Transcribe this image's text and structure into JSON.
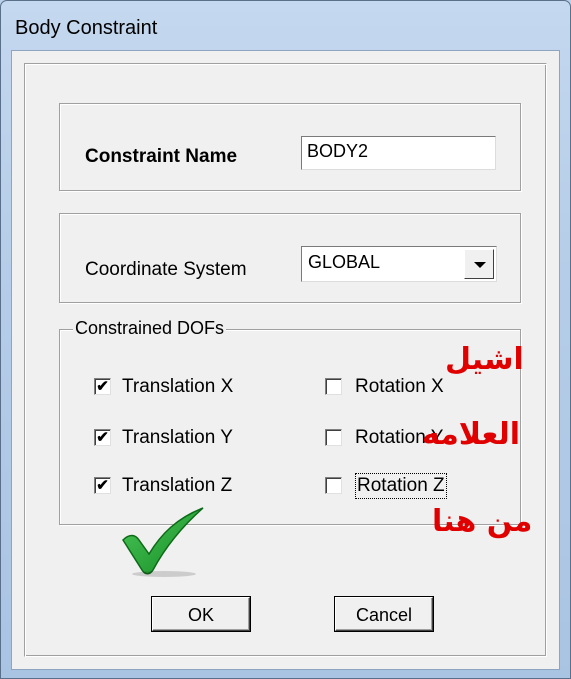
{
  "window": {
    "title": "Body Constraint"
  },
  "constraint_name": {
    "label": "Constraint Name",
    "value": "BODY2"
  },
  "coordinate_system": {
    "label": "Coordinate System",
    "value": "GLOBAL"
  },
  "dofs": {
    "legend": "Constrained DOFs",
    "translation": [
      {
        "label": "Translation X",
        "checked": true,
        "mark": "✔"
      },
      {
        "label": "Translation Y",
        "checked": true,
        "mark": "✔"
      },
      {
        "label": "Translation Z",
        "checked": true,
        "mark": "✔"
      }
    ],
    "rotation": [
      {
        "label": "Rotation X",
        "checked": false,
        "mark": ""
      },
      {
        "label": "Rotation Y",
        "checked": false,
        "mark": ""
      },
      {
        "label": "Rotation Z",
        "checked": false,
        "mark": ""
      }
    ]
  },
  "buttons": {
    "ok": "OK",
    "cancel": "Cancel"
  },
  "annotations": {
    "line1": "اشيل",
    "line2": "العلامه",
    "line3": "من هنا",
    "color": "#e00000",
    "checkmark_color": "#1a9a2a"
  }
}
